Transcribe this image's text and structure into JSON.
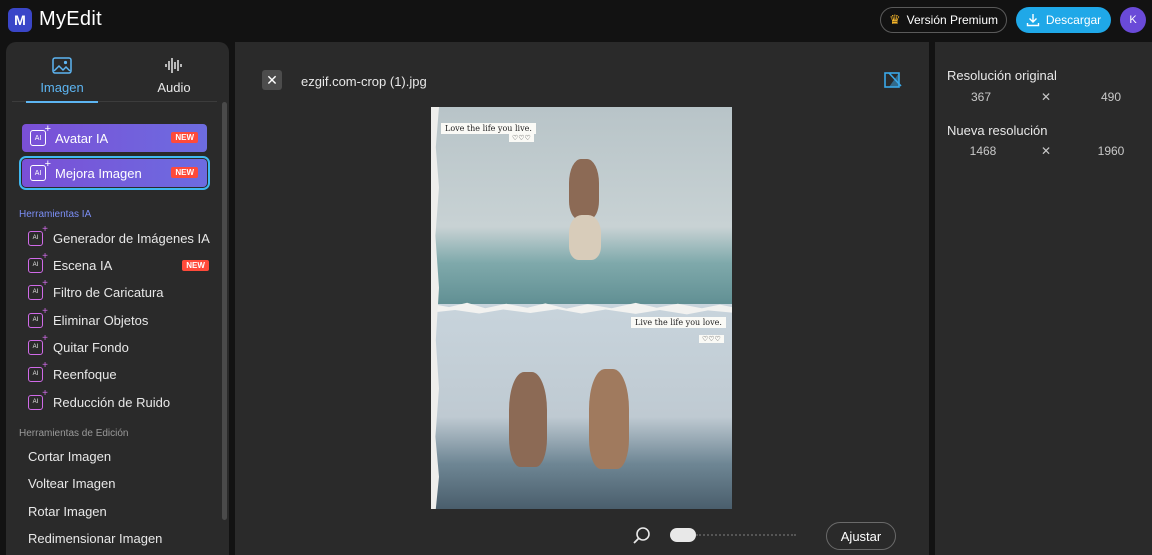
{
  "app": {
    "logo_letter": "M",
    "title": "MyEdit"
  },
  "header": {
    "premium_label": "Versión Premium",
    "download_label": "Descargar",
    "avatar_letter": "K"
  },
  "sidebar": {
    "tabs": [
      {
        "label": "Imagen",
        "active": true
      },
      {
        "label": "Audio",
        "active": false
      }
    ],
    "featured": [
      {
        "label": "Avatar IA",
        "badge": "NEW"
      },
      {
        "label": "Mejora Imagen",
        "badge": "NEW",
        "selected": true
      }
    ],
    "ai_section_label": "Herramientas IA",
    "ai_tools": [
      {
        "label": "Generador de Imágenes IA"
      },
      {
        "label": "Escena IA",
        "badge": "NEW"
      },
      {
        "label": "Filtro de Caricatura"
      },
      {
        "label": "Eliminar Objetos"
      },
      {
        "label": "Quitar Fondo"
      },
      {
        "label": "Reenfoque"
      },
      {
        "label": "Reducción de Ruido"
      }
    ],
    "edit_section_label": "Herramientas de Edición",
    "edit_tools": [
      {
        "label": "Cortar Imagen"
      },
      {
        "label": "Voltear Imagen"
      },
      {
        "label": "Rotar Imagen"
      },
      {
        "label": "Redimensionar Imagen"
      }
    ],
    "ai_icon_text": "AI"
  },
  "canvas": {
    "close_glyph": "✕",
    "filename": "ezgif.com-crop (1).jpg",
    "photo_notes": {
      "top_note": "Love the life you live.",
      "top_hearts": "♡♡♡",
      "bottom_note": "Live the life you love.",
      "bottom_hearts": "♡♡♡"
    },
    "adjust_label": "Ajustar"
  },
  "resolution": {
    "original_label": "Resolución original",
    "original_width": "367",
    "original_height": "490",
    "new_label": "Nueva resolución",
    "new_width": "1468",
    "new_height": "1960",
    "separator": "✕"
  },
  "colors": {
    "accent": "#5db5f2",
    "download": "#1fa8e8",
    "new_badge": "#ff4a3a",
    "premium_crown": "#f5b52a"
  }
}
